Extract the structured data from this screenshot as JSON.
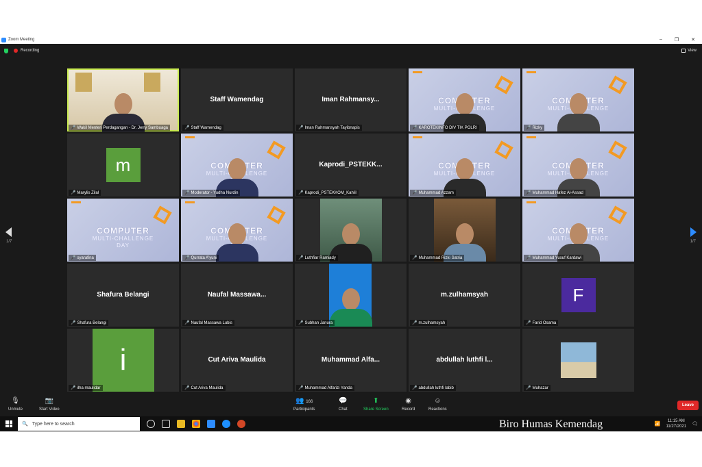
{
  "window": {
    "title": "Zoom Meeting",
    "min": "–",
    "max": "❐",
    "close": "✕"
  },
  "status": {
    "recording": "Recording",
    "view": "View"
  },
  "paging": {
    "left": "1/7",
    "right": "1/7"
  },
  "tiles": [
    {
      "label": "Wakil Menteri Perdagangan - Dr. Jerry Sambuaga",
      "kind": "video-office",
      "active": true
    },
    {
      "label": "Staff Wamendag",
      "name": "Staff Wamendag",
      "kind": "name"
    },
    {
      "label": "Iman Rahmansyah Tayibnapis",
      "name": "Iman  Rahmansy...",
      "kind": "name"
    },
    {
      "label": "KAROTEKINFO DIV TIK POLRI",
      "kind": "banner-person"
    },
    {
      "label": "Rizky",
      "kind": "banner-person"
    },
    {
      "label": "Marylis Zilal",
      "avatar": "m",
      "avatar_color": "#5a9e3c",
      "kind": "avatar"
    },
    {
      "label": "Moderator - Yudha Nurdin",
      "kind": "banner-person"
    },
    {
      "label": "Kaprodi_PSTEKKOM_Kahlil",
      "name": "Kaprodi_PSTEKK...",
      "kind": "name"
    },
    {
      "label": "Muhammad Azzam",
      "kind": "banner-person"
    },
    {
      "label": "Muhammad Hafez Al-Assad",
      "kind": "banner-person"
    },
    {
      "label": "syarafina",
      "kind": "banner"
    },
    {
      "label": "Qurrata A'yuni",
      "kind": "banner-person"
    },
    {
      "label": "Luthfiar Ramiady",
      "kind": "photo"
    },
    {
      "label": "Muhammad Rizki Satria",
      "kind": "photo-cafe"
    },
    {
      "label": "Muhammad Yusuf Kardawi",
      "kind": "banner-person"
    },
    {
      "label": "Shafura Belangi",
      "name": "Shafura Belangi",
      "kind": "name"
    },
    {
      "label": "Naufal Massawa Lubis",
      "name": "Naufal  Massawa...",
      "kind": "name"
    },
    {
      "label": "Subhan Janura",
      "kind": "photo-blue"
    },
    {
      "label": "m.zulhamsyah",
      "name": "m.zulhamsyah",
      "kind": "name"
    },
    {
      "label": "Farid Osama",
      "avatar": "F",
      "avatar_color": "#4b2a9e",
      "kind": "avatar"
    },
    {
      "label": "ilha maulidar",
      "avatar": "i",
      "avatar_color": "#5a9e3c",
      "kind": "avatar-big"
    },
    {
      "label": "Cut Ariva Maulida",
      "name": "Cut Ariva Maulida",
      "kind": "name"
    },
    {
      "label": "Muhammad Alfarizi Yanda",
      "name": "Muhammad  Alfa...",
      "kind": "name"
    },
    {
      "label": "abdullah luthfi labib",
      "name": "abdullah luthfi l...",
      "kind": "name"
    },
    {
      "label": "Muhazar",
      "kind": "photo-beach"
    }
  ],
  "banner": {
    "line1": "COMPUTER",
    "line2": "MULTI-CHALLENGE",
    "line3": "DAY"
  },
  "toolbar": {
    "unmute": "Unmute",
    "start_video": "Start Video",
    "participants": "Participants",
    "participants_count": "166",
    "chat": "Chat",
    "share": "Share Screen",
    "record": "Record",
    "reactions": "Reactions",
    "leave": "Leave"
  },
  "taskbar": {
    "search_placeholder": "Type here to search",
    "time": "11:15 AM",
    "date": "11/27/2021"
  },
  "watermark": "Biro Humas Kemendag",
  "colors": {
    "accent": "#2d8cff",
    "leave": "#e02828",
    "active_speaker": "#c8ea50",
    "share": "#23d160"
  }
}
